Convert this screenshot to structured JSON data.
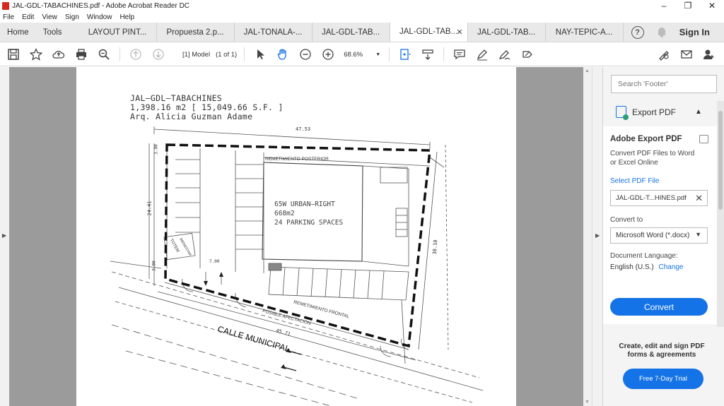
{
  "window": {
    "title": "JAL-GDL-TABACHINES.pdf - Adobe Acrobat Reader DC",
    "controls": [
      "–",
      "❐",
      "✕"
    ]
  },
  "menu": [
    "File",
    "Edit",
    "View",
    "Sign",
    "Window",
    "Help"
  ],
  "tabs": {
    "home": "Home",
    "tools": "Tools",
    "documents": [
      {
        "label": "LAYOUT PINT..."
      },
      {
        "label": "Propuesta 2.p..."
      },
      {
        "label": "JAL-TONALA-..."
      },
      {
        "label": "JAL-GDL-TAB..."
      },
      {
        "label": "JAL-GDL-TAB...",
        "active": true
      },
      {
        "label": "JAL-GDL-TAB..."
      },
      {
        "label": "NAY-TEPIC-A..."
      }
    ],
    "help_glyph": "?",
    "sign_in": "Sign In"
  },
  "toolbar": {
    "page_label": "[1] Model",
    "page_count": "(1 of 1)",
    "zoom": "68.6%"
  },
  "document": {
    "plan_title_lines": [
      "JAL–GDL–TABACHINES",
      "1,398.16 m2  [ 15,049.66 S.F. ]",
      "Arq. Alicia Guzman Adame"
    ],
    "info_lines": [
      "65W URBAN–RIGHT",
      "668m2",
      "24 PARKING SPACES"
    ],
    "labels": {
      "dim_top": "47.53",
      "dim_left": "24.41",
      "dim_right": "38.10",
      "dim_bottom": "45.71",
      "dim_3a": "3.00",
      "dim_3b": "3.00",
      "dim_7": "7.00",
      "rear_setback": "REMETIMIENTO POSTERIOR",
      "front_setback": "REMETIMIENTO FRONTAL",
      "affectation": "POSIBLE AFECTACION",
      "street": "CALLE MUNICIPAL",
      "totem": "TOTEM",
      "totem_sub": "BIENESTAR"
    }
  },
  "panel": {
    "search_placeholder": "Search 'Footer'",
    "export_title": "Export PDF",
    "card_title": "Adobe Export PDF",
    "card_desc": "Convert PDF Files to Word or Excel Online",
    "select_file": "Select PDF File",
    "file_name": "JAL-GDL-T...HINES.pdf",
    "convert_to": "Convert to",
    "format": "Microsoft Word (*.docx)",
    "doc_lang_label": "Document Language:",
    "doc_lang": "English (U.S.)",
    "change": "Change",
    "convert_button": "Convert",
    "promo": "Create, edit and sign PDF forms & agreements",
    "trial_button": "Free 7-Day Trial"
  },
  "colors": {
    "accent": "#1473e6",
    "doc_bg": "#9b9b9b"
  }
}
